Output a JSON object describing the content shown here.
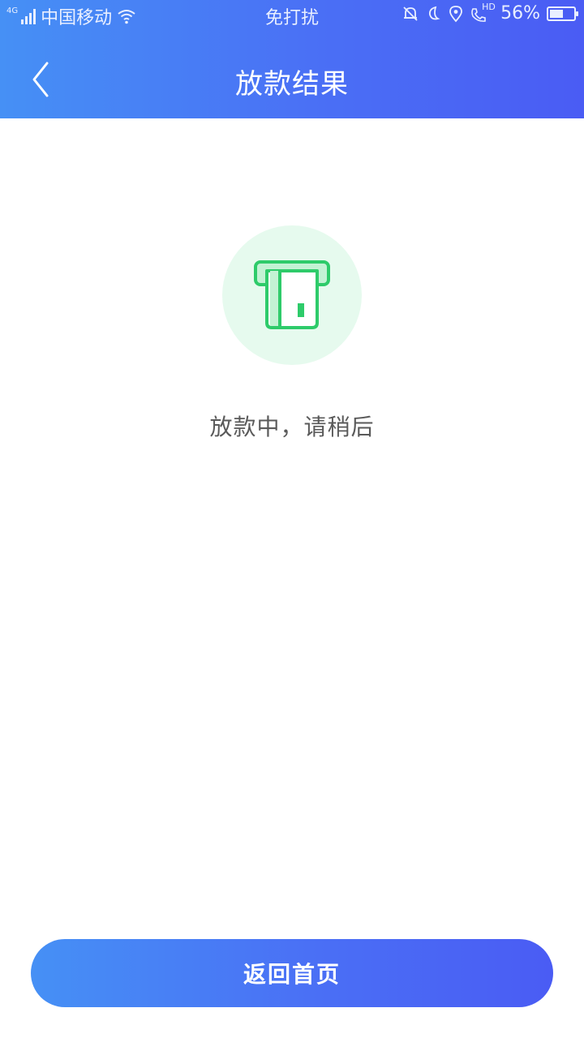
{
  "status_bar": {
    "network_type": "4G",
    "carrier": "中国移动",
    "mode": "免打扰",
    "battery_percent": "56%",
    "battery_level": 0.56,
    "hd_label": "HD",
    "icons": [
      "signal-icon",
      "wifi-icon",
      "bell-muted-icon",
      "moon-icon",
      "location-icon",
      "hd-call-icon",
      "battery-icon"
    ]
  },
  "header": {
    "title": "放款结果",
    "back_icon": "chevron-left-icon"
  },
  "main": {
    "status_icon": "card-dispense-icon",
    "status_text": "放款中，请稍后"
  },
  "footer": {
    "home_button_label": "返回首页"
  },
  "colors": {
    "accent_start": "#4690f5",
    "accent_end": "#4a5cf4",
    "success_green": "#2ecb6a",
    "success_bg": "#e6faee",
    "text_gray": "#5a5a5a"
  }
}
